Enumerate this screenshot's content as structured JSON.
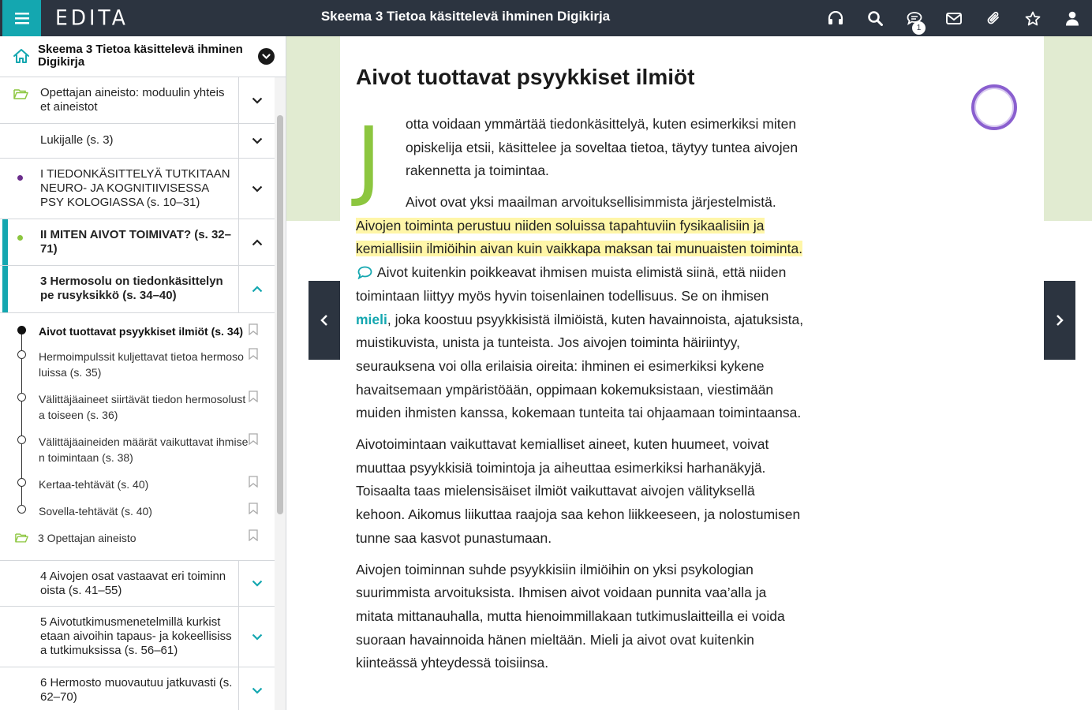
{
  "topbar": {
    "logo": "EDITA",
    "title": "Skeema 3 Tietoa käsittelevä ihminen Digikirja",
    "icons": [
      "headphones-icon",
      "search-icon",
      "comment-icon",
      "mail-icon",
      "paperclip-icon",
      "star-icon",
      "user-icon"
    ],
    "comment_count": "1"
  },
  "sidebar": {
    "book_title": "Skeema 3 Tietoa käsittelevä ihminen Digikirja",
    "rows": [
      {
        "label": "Opettajan aineisto: moduulin yhteis et aineistot"
      },
      {
        "label": "Lukijalle (s. 3)"
      },
      {
        "label": "I TIEDONKÄSITTELYÄ TUTKITAAN NEURO- JA KOGNITIIVISESSA PSY KOLOGIASSA (s. 10–31)"
      },
      {
        "label": "II MITEN AIVOT TOIMIVAT? (s. 32–71)"
      },
      {
        "label": "3 Hermosolu on tiedonkäsittelyn pe rusyksikkö (s. 34–40)"
      },
      {
        "label": "4 Aivojen osat vastaavat eri toiminn oista (s. 41–55)"
      },
      {
        "label": "5 Aivotutkimusmenetelmillä kurkist etaan aivoihin tapaus- ja kokeellisiss a tutkimuksissa (s. 56–61)"
      },
      {
        "label": "6 Hermosto muovautuu jatkuvasti (s. 62–70)"
      }
    ],
    "subs": [
      {
        "label": "Aivot tuottavat psyykkiset ilmiöt (s. 34)"
      },
      {
        "label": "Hermoimpulssit kuljettavat tietoa hermoso luissa (s. 35)"
      },
      {
        "label": "Välittäjäaineet siirtävät tiedon hermosolust a toiseen (s. 36)"
      },
      {
        "label": "Välittäjäaineiden määrät vaikuttavat ihmise n toimintaan (s. 38)"
      },
      {
        "label": "Kertaa-tehtävät (s. 40)"
      },
      {
        "label": "Sovella-tehtävät (s. 40)"
      },
      {
        "label": "3 Opettajan aineisto"
      }
    ]
  },
  "colors": {
    "accent": "#14a7b0",
    "topbar": "#2c3440",
    "green": "#8cc63f",
    "purple": "#8a5fcf",
    "highlight": "#fff6a8"
  },
  "content": {
    "heading": "Aivot tuottavat psyykkiset ilmiöt",
    "dropcap": "J",
    "p1": "otta voidaan ymmärtää tiedonkäsittelyä, kuten esimerkiksi miten opiskelija etsii, käsittelee ja soveltaa tietoa, täytyy tuntea aivojen rakennetta ja toimintaa.",
    "p2_start": "Aivot ovat yksi maailman arvoituksellisimmista järjestelmistä.",
    "p2_highlight": "Aivojen toiminta perustuu niiden soluissa tapahtuviin fysikaalisiin ja kemiallisiin ilmiöihin aivan kuin vaikkapa maksan tai munuaisten toiminta.",
    "p2_mid": "Aivot kuitenkin poikkeavat ihmisen muista elimistä siinä, että niiden toimintaan liittyy myös hyvin toisenlainen todellisuus. Se on ihmisen",
    "p2_term": "mieli",
    "p2_end": ", joka koostuu psyykkisistä ilmiöistä, kuten havainnoista, ajatuksista, muistikuvista, unista ja tunteista. Jos aivojen toiminta häiriintyy, seurauksena voi olla erilaisia oireita: ihminen ei esimerkiksi kykene havaitsemaan ympäristöään, oppimaan kokemuksistaan, viestimään muiden ihmisten kanssa, kokemaan tunteita tai ohjaamaan toimintaansa.",
    "p3": "Aivotoimintaan vaikuttavat kemialliset aineet, kuten huumeet, voivat muuttaa psyykkisiä toimintoja ja aiheuttaa esimerkiksi harhanäkyjä. Toisaalta taas mielensisäiset ilmiöt vaikuttavat aivojen välityksellä kehoon. Aikomus liikuttaa raajoja saa kehon liikkeeseen, ja nolostumisen tunne saa kasvot punastumaan.",
    "p4": "Aivojen toiminnan suhde psyykkisiin ilmiöihin on yksi psykologian suurimmista arvoituksista. Ihmisen aivot voidaan punnita vaa’alla ja mitata mittanauhalla, mutta hienoimmillakaan tutkimuslaitteilla ei voida suoraan havainnoida hänen mieltään. Mieli ja aivot ovat kuitenkin kiinteässä yhteydessä toisiinsa."
  }
}
